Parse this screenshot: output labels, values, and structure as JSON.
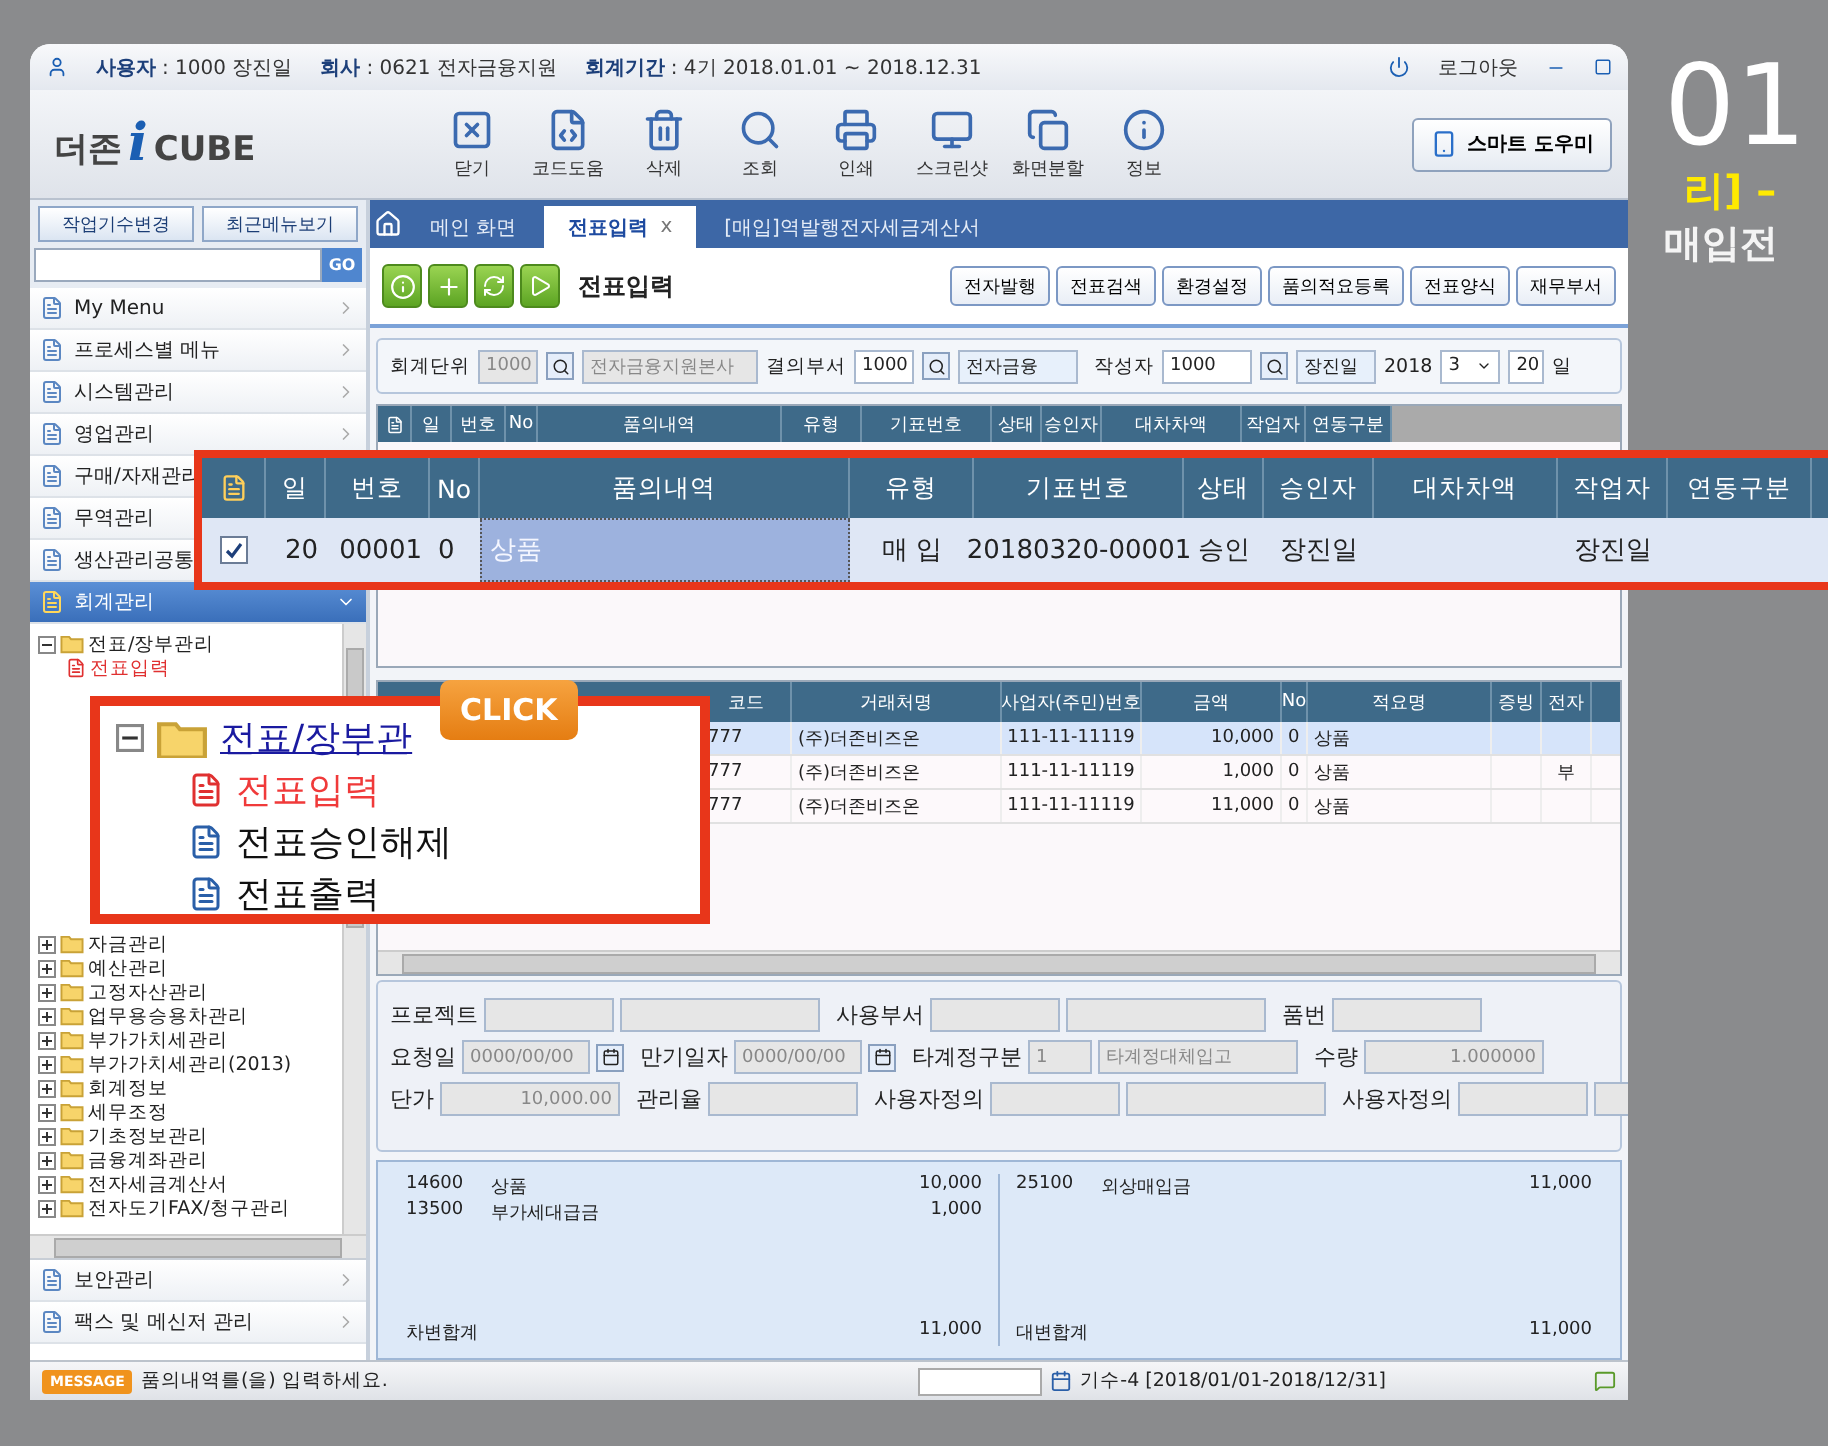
{
  "session": {
    "user_label": "사용자",
    "user": ": 1000 장진일",
    "company_label": "회사",
    "company": ": 0621 전자금융지원",
    "period_label": "회계기간",
    "period": ": 4기 2018.01.01 ~ 2018.12.31",
    "logout": "로그아웃"
  },
  "logo": {
    "prefix": "더존",
    "mark": "i",
    "suffix": "CUBE"
  },
  "toolbar": [
    {
      "label": "닫기",
      "kind": "close"
    },
    {
      "label": "코드도움",
      "kind": "code"
    },
    {
      "label": "삭제",
      "kind": "delete"
    },
    {
      "label": "조회",
      "kind": "search"
    },
    {
      "label": "인쇄",
      "kind": "print"
    },
    {
      "label": "스크린샷",
      "kind": "screenshot"
    },
    {
      "label": "화면분할",
      "kind": "split"
    },
    {
      "label": "정보",
      "kind": "info"
    }
  ],
  "smart_button": "스마트 도우미",
  "sidebar": {
    "buttons": [
      "작업기수변경",
      "최근메뉴보기"
    ],
    "search_button": "GO",
    "menus": [
      {
        "label": "My Menu",
        "selected": false
      },
      {
        "label": "프로세스별 메뉴",
        "selected": false
      },
      {
        "label": "시스템관리",
        "selected": false
      },
      {
        "label": "영업관리",
        "selected": false
      },
      {
        "label": "구매/자재관리",
        "selected": false
      },
      {
        "label": "무역관리",
        "selected": false
      },
      {
        "label": "생산관리공통",
        "selected": false
      },
      {
        "label": "회계관리",
        "selected": true
      }
    ],
    "tree": [
      {
        "label": "전표/장부관리",
        "expanded": true,
        "children": [
          {
            "label": "전표입력",
            "selected": true
          }
        ]
      },
      {
        "label": "자금관리",
        "expanded": false
      },
      {
        "label": "예산관리",
        "expanded": false
      },
      {
        "label": "고정자산관리",
        "expanded": false
      },
      {
        "label": "업무용승용차관리",
        "expanded": false
      },
      {
        "label": "부가가치세관리",
        "expanded": false
      },
      {
        "label": "부가가치세관리(2013)",
        "expanded": false
      },
      {
        "label": "회계정보",
        "expanded": false
      },
      {
        "label": "세무조정",
        "expanded": false
      },
      {
        "label": "기초정보관리",
        "expanded": false
      },
      {
        "label": "금융계좌관리",
        "expanded": false
      },
      {
        "label": "전자세금계산서",
        "expanded": false
      },
      {
        "label": "전자도기FAX/청구관리",
        "expanded": false
      }
    ],
    "bottom_menus": [
      "보안관리",
      "팩스 및 메신저 관리"
    ]
  },
  "tabs": [
    {
      "label": "메인 화면",
      "selected": false
    },
    {
      "label": "전표입력",
      "selected": true,
      "close": "x"
    },
    {
      "label": "[매입]역발행전자세금계산서",
      "selected": false
    }
  ],
  "form": {
    "title": "전표입력",
    "actions": [
      "전자발행",
      "전표검색",
      "환경설정",
      "품의적요등록",
      "전표양식",
      "재무부서"
    ]
  },
  "filter": {
    "unit_label": "회계단위",
    "unit_code": "1000",
    "unit_name": "전자금융지원본사",
    "unit_disabled": true,
    "dept_label": "결의부서",
    "dept_code": "1000",
    "dept_name": "전자금융",
    "writer_label": "작성자",
    "writer_code": "1000",
    "writer_name": "장진일",
    "year": "2018",
    "month": "3",
    "day": "20",
    "day_label": "일"
  },
  "voucher_grid": {
    "columns": [
      "일",
      "번호",
      "No",
      "품의내역",
      "유형",
      "기표번호",
      "상태",
      "승인자",
      "대차차액",
      "작업자",
      "연동구분"
    ]
  },
  "zoom_grid": {
    "columns": [
      "일",
      "번호",
      "No",
      "품의내역",
      "유형",
      "기표번호",
      "상태",
      "승인자",
      "대차차액",
      "작업자",
      "연동구분"
    ],
    "row": {
      "checked": true,
      "day": "20",
      "number": "00001",
      "no": "0",
      "description": "상품",
      "type": "매  입",
      "voucher_no": "20180320-00001",
      "status": "승인",
      "approver": "장진일",
      "worker": "장진일"
    }
  },
  "detail_grid": {
    "columns": [
      "코드",
      "거래처명",
      "사업자(주민)번호",
      "금액",
      "No",
      "적요명",
      "증빙",
      "전자"
    ],
    "rows": [
      {
        "code": "777",
        "partner": "(주)더존비즈온",
        "biz_no": "111-11-11119",
        "amount": "10,000",
        "no": "0",
        "memo": "상품",
        "selected": true
      },
      {
        "code": "777",
        "partner": "(주)더존비즈온",
        "biz_no": "111-11-11119",
        "amount": "1,000",
        "no": "0",
        "memo": "상품",
        "electronic": "부",
        "selected": false
      },
      {
        "code": "777",
        "partner": "(주)더존비즈온",
        "biz_no": "111-11-11119",
        "amount": "11,000",
        "no": "0",
        "memo": "상품",
        "selected": false
      }
    ]
  },
  "details": [
    [
      {
        "label": "프로젝트",
        "kind": "pair"
      },
      {
        "label": "사용부서",
        "kind": "pair"
      },
      {
        "label": "품번",
        "kind": "single"
      }
    ],
    [
      {
        "label": "요청일",
        "kind": "date",
        "value": "0000/00/00"
      },
      {
        "label": "만기일자",
        "kind": "date",
        "value": "0000/00/00"
      },
      {
        "label": "타계정구분",
        "kind": "pair",
        "value": "1",
        "name": "타계정대체입고"
      },
      {
        "label": "수량",
        "kind": "single",
        "value": "1.000000"
      }
    ],
    [
      {
        "label": "단가",
        "kind": "single",
        "value": "10,000.00"
      },
      {
        "label": "관리율",
        "kind": "single"
      },
      {
        "label": "사용자정의",
        "kind": "pair"
      },
      {
        "label": "사용자정의",
        "kind": "pair"
      }
    ]
  ],
  "summary": {
    "debit": [
      {
        "code": "14600",
        "name": "상품",
        "amount": "10,000"
      },
      {
        "code": "13500",
        "name": "부가세대급금",
        "amount": "1,000"
      }
    ],
    "debit_total_label": "차변합계",
    "debit_total": "11,000",
    "credit": [
      {
        "code": "25100",
        "name": "외상매입금",
        "amount": "11,000"
      }
    ],
    "credit_total_label": "대변합계",
    "credit_total": "11,000"
  },
  "status": {
    "badge": "MESSAGE",
    "message": "품의내역를(을) 입력하세요.",
    "period": "기수-4 [2018/01/01-2018/12/31]"
  },
  "tree_callout": {
    "badge": "CLICK",
    "parent": "전표/장부관",
    "children": [
      {
        "label": "전표입력",
        "selected": true
      },
      {
        "label": "전표승인해제",
        "selected": false
      },
      {
        "label": "전표출력",
        "selected": false
      }
    ]
  },
  "side_caption": {
    "number": "01",
    "line1": "리] –",
    "line2": "매입전"
  }
}
